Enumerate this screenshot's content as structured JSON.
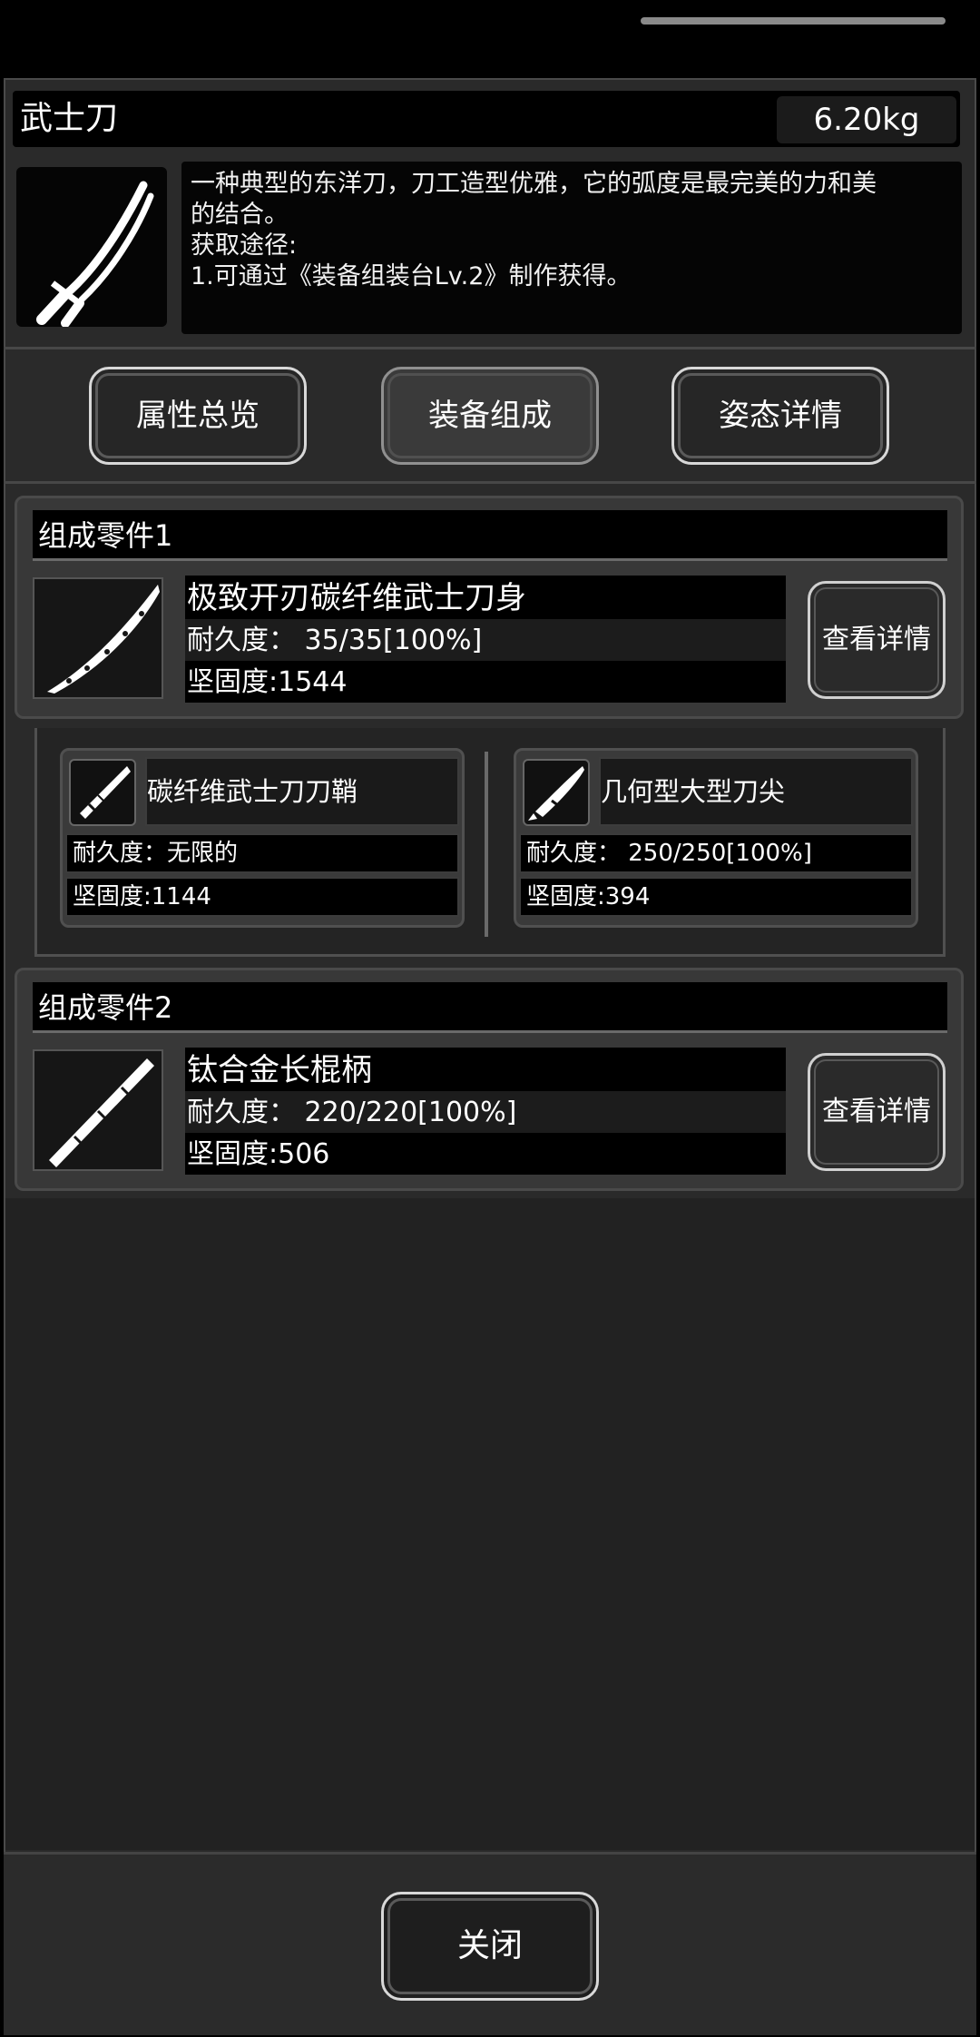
{
  "item": {
    "name": "武士刀",
    "weight": "6.20kg",
    "icon": "katana-icon",
    "description_lines": [
      "一种典型的东洋刀，刀工造型优雅，它的弧度是最完美的力和美",
      "的结合。",
      "获取途径:",
      "1.可通过《装备组装台Lv.2》制作获得。"
    ]
  },
  "tabs": [
    {
      "label": "属性总览",
      "active": false
    },
    {
      "label": "装备组成",
      "active": true
    },
    {
      "label": "姿态详情",
      "active": false
    }
  ],
  "components": [
    {
      "title": "组成零件1",
      "name": "极致开刃碳纤维武士刀身",
      "durability": "耐久度：  35/35[100%]",
      "hardness": "坚固度:1544",
      "detail_label": "查看详情",
      "icon": "blade-icon",
      "sub_parts": [
        {
          "name": "碳纤维武士刀刀鞘",
          "durability": "耐久度：无限的",
          "hardness": "坚固度:1144",
          "icon": "scabbard-icon"
        },
        {
          "name": "几何型大型刀尖",
          "durability": "耐久度：  250/250[100%]",
          "hardness": "坚固度:394",
          "icon": "blade-tip-icon"
        }
      ]
    },
    {
      "title": "组成零件2",
      "name": "钛合金长棍柄",
      "durability": "耐久度：  220/220[100%]",
      "hardness": "坚固度:506",
      "detail_label": "查看详情",
      "icon": "handle-icon"
    }
  ],
  "close_label": "关闭"
}
